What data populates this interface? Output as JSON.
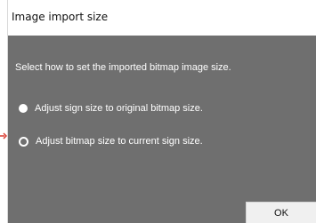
{
  "dialog": {
    "title": "Image import size",
    "instruction": "Select how to set the imported bitmap image size.",
    "options": [
      {
        "label": "Adjust sign size to original bitmap size.",
        "selected": false
      },
      {
        "label": "Adjust bitmap size to current sign size.",
        "selected": true
      }
    ],
    "ok_label": "OK"
  },
  "colors": {
    "panel_background": "#6f6f6f",
    "text_on_panel": "#ffffff",
    "pointer_arrow": "#d93a2f"
  },
  "icons": {
    "pointer": "red-arrow-icon"
  }
}
